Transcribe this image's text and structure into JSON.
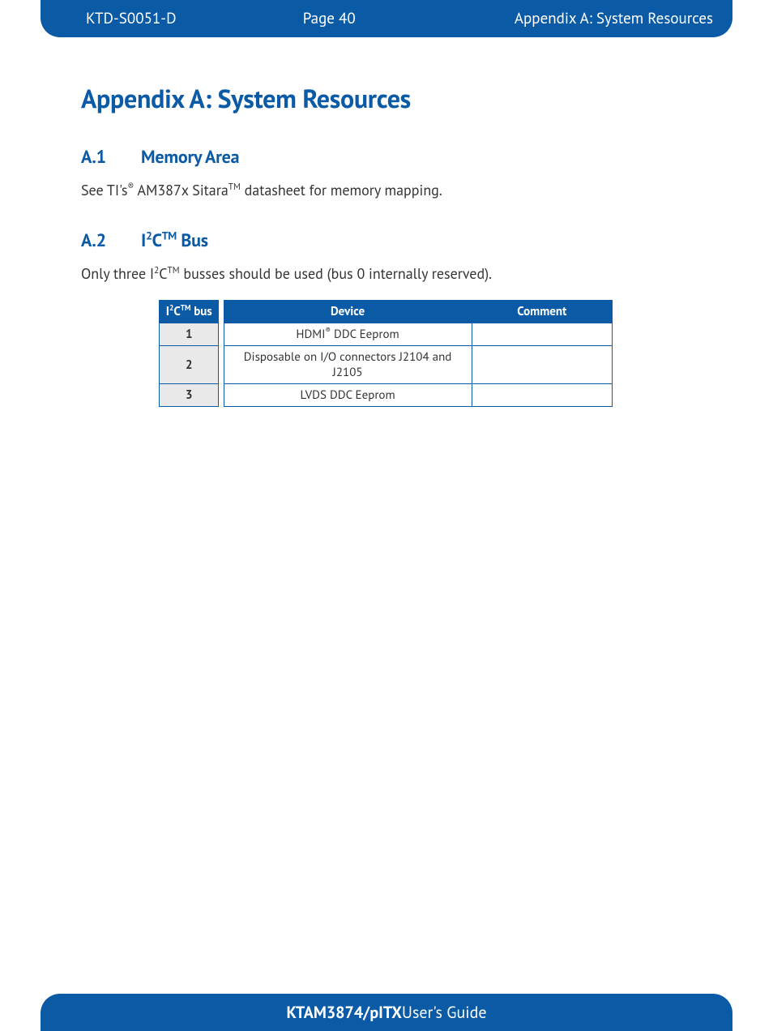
{
  "header": {
    "doc_id": "KTD-S0051-D",
    "page": "Page 40",
    "section": "Appendix A: System Resources"
  },
  "title": "Appendix A: System Resources",
  "a1": {
    "num": "A.1",
    "title": "Memory Area",
    "body_pre": "See TI's",
    "body_mid": " AM387x Sitara",
    "body_post": " datasheet for memory mapping."
  },
  "a2": {
    "num": "A.2",
    "title_pre": "I",
    "title_sup": "2",
    "title_mid": "C",
    "title_tm": "TM",
    "title_post": " Bus",
    "body_pre": "Only three I",
    "body_sup": "2",
    "body_mid": "C",
    "body_tm": "TM",
    "body_post": " busses should be used (bus 0 internally reserved)."
  },
  "table": {
    "headers": {
      "bus_pre": "I",
      "bus_sup": "2",
      "bus_mid": "C",
      "bus_tm": "TM",
      "bus_post": " bus",
      "device": "Device",
      "comment": "Comment"
    },
    "rows": [
      {
        "bus": "1",
        "device_pre": "HDMI",
        "device_sup": "®",
        "device_post": " DDC Eeprom",
        "comment": ""
      },
      {
        "bus": "2",
        "device_pre": "Disposable on I/O connectors J2104 and J2105",
        "device_sup": "",
        "device_post": "",
        "comment": ""
      },
      {
        "bus": "3",
        "device_pre": "LVDS DDC Eeprom",
        "device_sup": "",
        "device_post": "",
        "comment": ""
      }
    ]
  },
  "footer": {
    "strong": "KTAM3874/pITX",
    "rest": " User's Guide"
  },
  "symbols": {
    "reg": "®",
    "tm": "TM"
  }
}
